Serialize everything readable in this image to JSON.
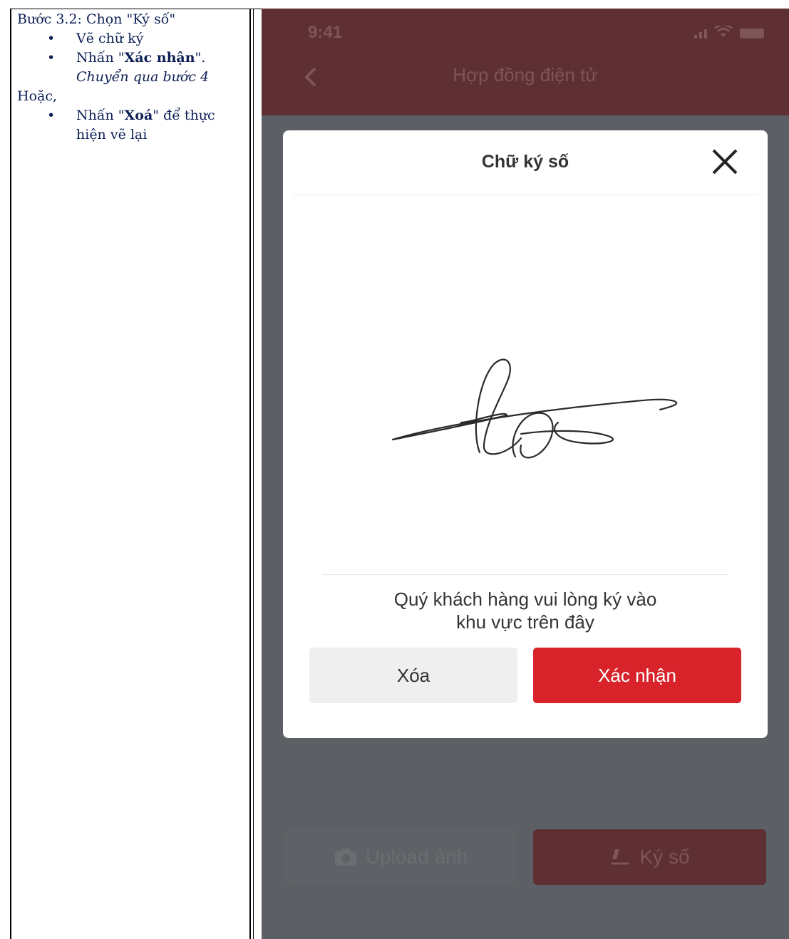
{
  "instructions": {
    "line1": "Bước 3.2: Chọn \"Ký số\"",
    "bullet1": "Vẽ chữ ký",
    "bullet2_prefix": "Nhấn \"",
    "bullet2_bold": "Xác nhận",
    "bullet2_suffix": "\".",
    "bullet2_italic": "Chuyển qua bước 4",
    "or": "Hoặc,",
    "bullet3_prefix": "Nhấn \"",
    "bullet3_bold": "Xoá",
    "bullet3_suffix": "\" để thực",
    "bullet3_line2": "hiện vẽ lại"
  },
  "phone": {
    "status_time": "9:41",
    "nav_title": "Hợp đồng điện tử",
    "upload_label": "Upload ảnh",
    "sign_label": "Ký số"
  },
  "modal": {
    "title": "Chữ ký số",
    "hint_line1": "Quý khách hàng vui lòng ký vào",
    "hint_line2": "khu vực trên đây",
    "clear_label": "Xóa",
    "confirm_label": "Xác nhận"
  },
  "colors": {
    "confirm": "#d8232a",
    "header_dim": "#5e2f33",
    "overlay": "#5c6064"
  },
  "icons": [
    "back-icon",
    "signal-icon",
    "wifi-icon",
    "battery-icon",
    "close-icon",
    "camera-icon",
    "signature-pen-icon"
  ]
}
